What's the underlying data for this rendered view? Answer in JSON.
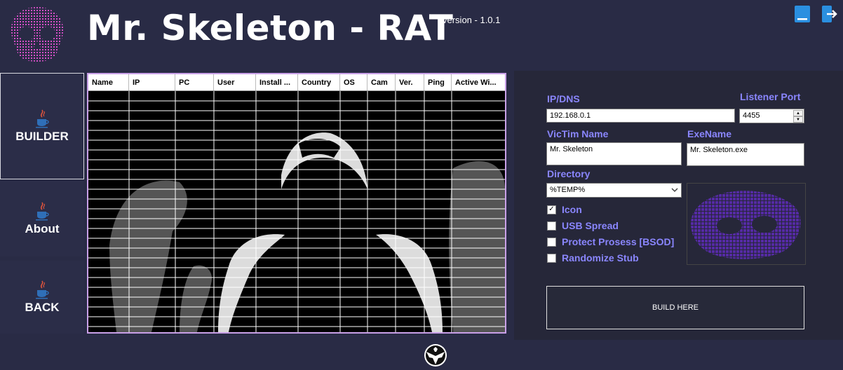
{
  "header": {
    "title": "Mr. Skeleton - RAT",
    "version": "version - 1.0.1"
  },
  "nav": [
    {
      "label": "BUILDER",
      "active": true
    },
    {
      "label": "About",
      "active": false
    },
    {
      "label": "BACK",
      "active": false
    }
  ],
  "grid": {
    "columns": [
      "Name",
      "IP",
      "PC",
      "User",
      "Install ...",
      "Country",
      "OS",
      "Cam",
      "Ver.",
      "Ping",
      "Active Wi..."
    ],
    "rows": []
  },
  "builder": {
    "ip_label": "IP/DNS",
    "ip_value": "192.168.0.1",
    "port_label": "Listener Port",
    "port_value": "4455",
    "victim_label": "VicTim Name",
    "victim_value": "Mr. Skeleton",
    "exe_label": "ExeName",
    "exe_value": "Mr. Skeleton.exe",
    "dir_label": "Directory",
    "dir_value": "%TEMP%",
    "options": [
      {
        "label": "Icon",
        "checked": true
      },
      {
        "label": "USB Spread",
        "checked": false
      },
      {
        "label": "Protect Prosess [BSOD]",
        "checked": false
      },
      {
        "label": "Randomize Stub",
        "checked": false
      }
    ],
    "build_label": "BUILD HERE"
  },
  "colors": {
    "background": "#292b45",
    "accent_label": "#8a86ff",
    "logo_pink": "#d44fc6",
    "preview_purple": "#5a2bb0"
  },
  "icons": [
    "skull-logo-icon",
    "minimize-icon",
    "exit-icon",
    "java-icon",
    "shield-eagle-icon"
  ]
}
